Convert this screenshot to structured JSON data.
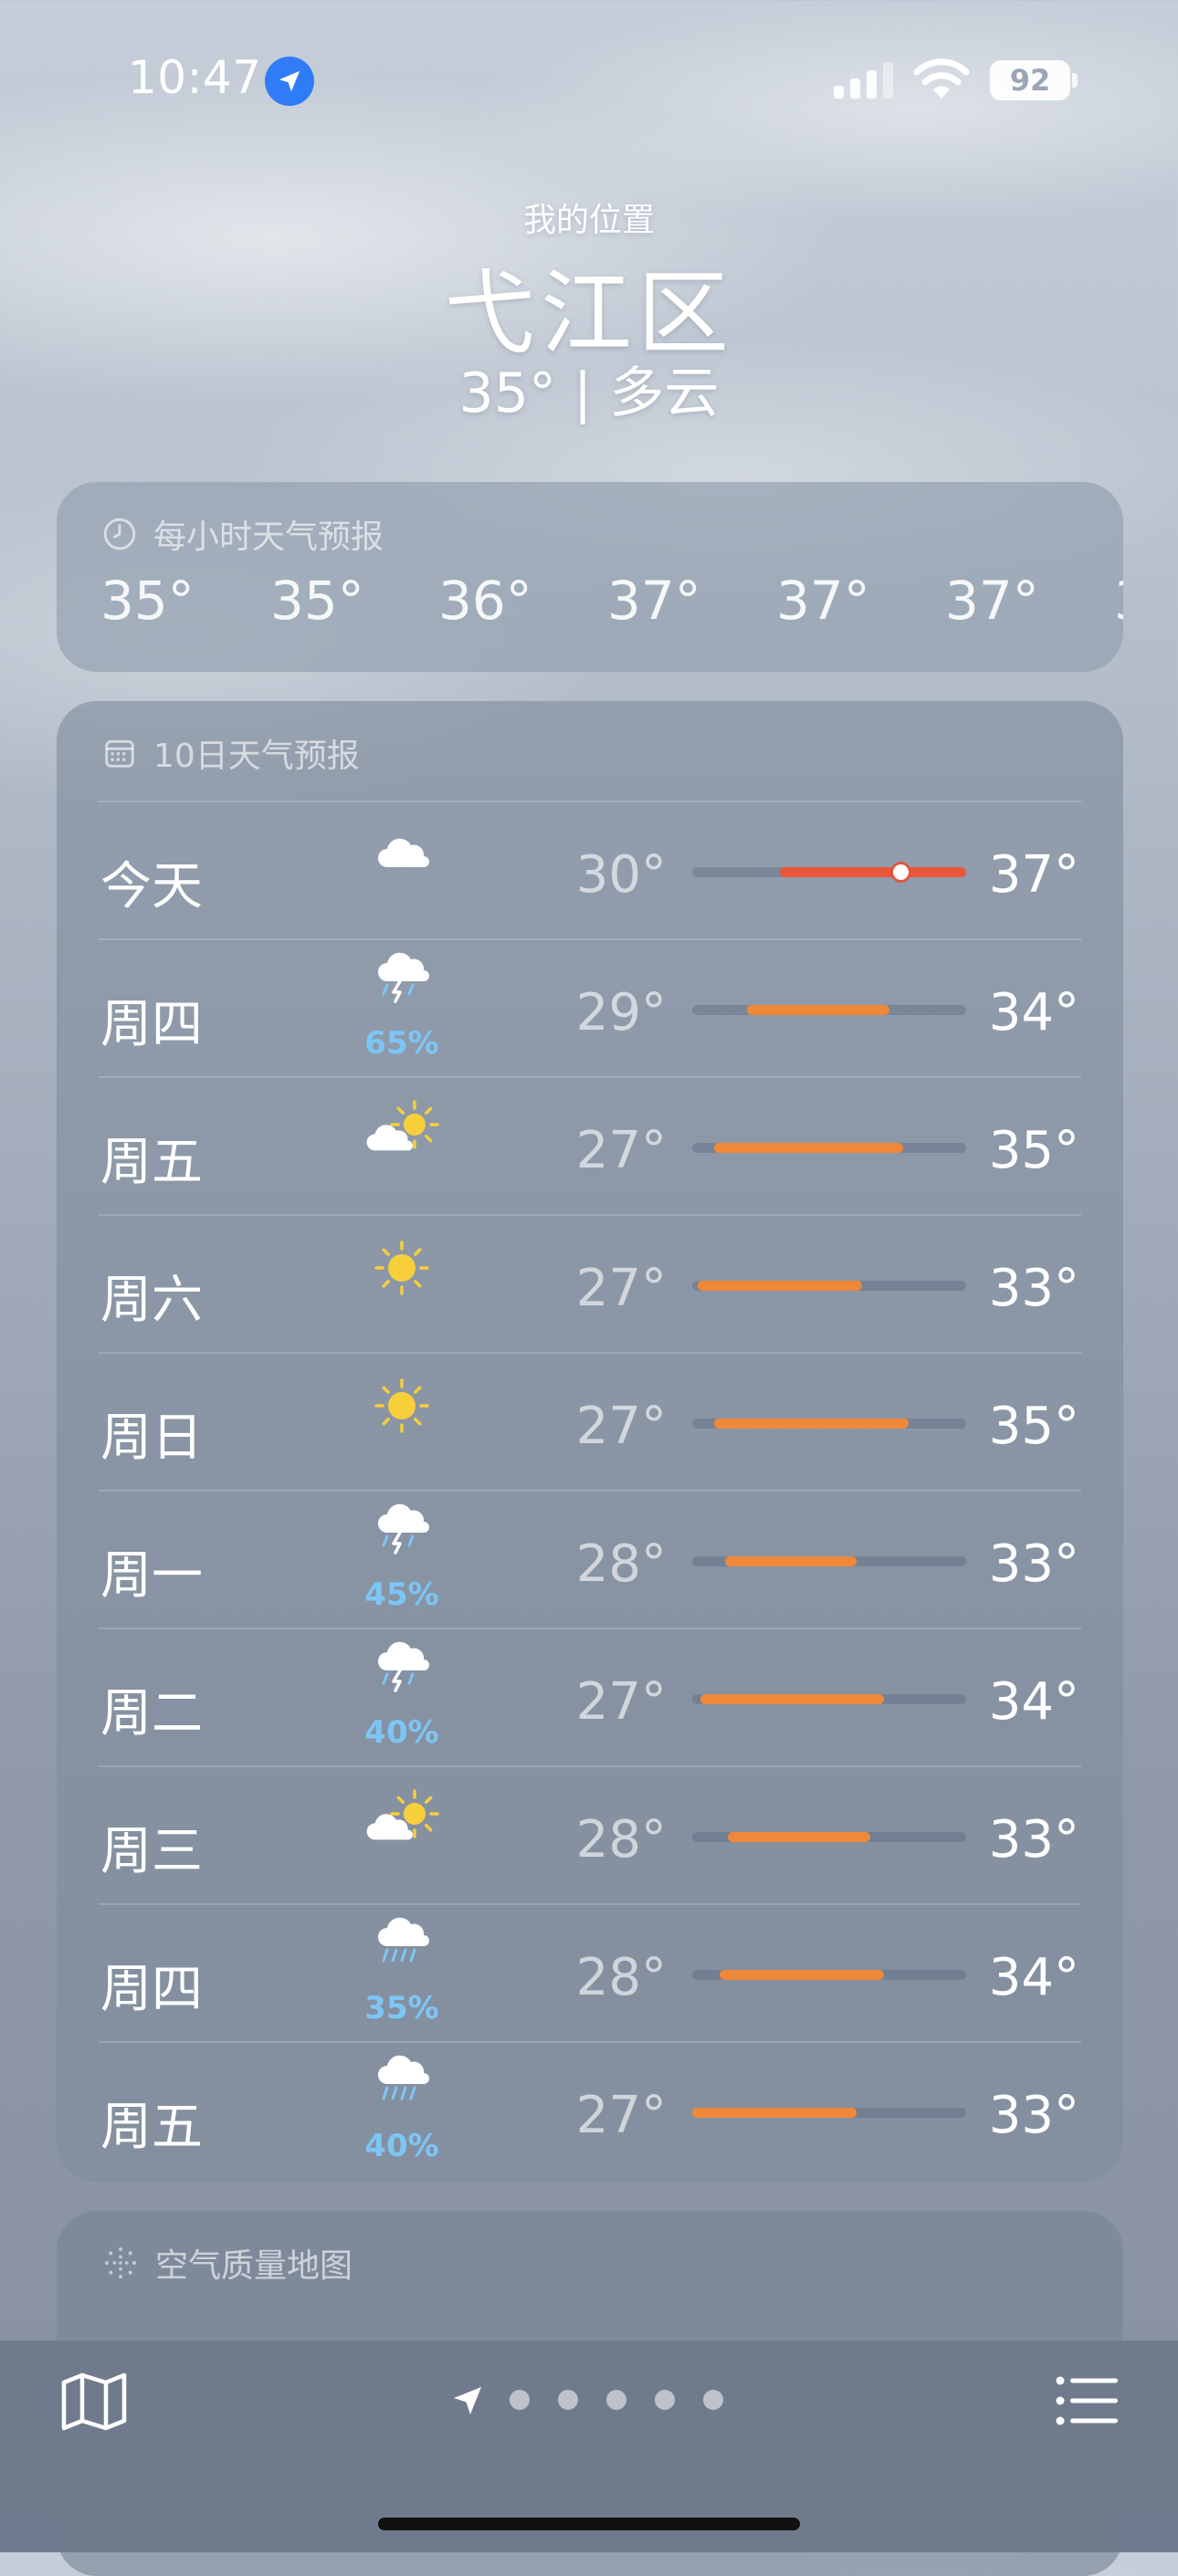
{
  "status": {
    "time": "10:47",
    "battery": "92"
  },
  "header": {
    "label": "我的位置",
    "city": "弋江区",
    "condition": "35° | 多云"
  },
  "hourly": {
    "title": "每小时天气预报",
    "temps": [
      "35°",
      "35°",
      "36°",
      "37°",
      "37°",
      "37°",
      "3"
    ]
  },
  "daily": {
    "title": "10日天气预报",
    "colors": {
      "bar_today": "#e8573a",
      "bar": "#f0883a",
      "precip_text": "#7cc6f5"
    },
    "rows": [
      {
        "day": "今天",
        "icon": "cloud-icon",
        "pop": "",
        "lo": "30°",
        "hi": "37°",
        "range": [
          0.32,
          1.0
        ],
        "current": 0.76
      },
      {
        "day": "周四",
        "icon": "thunderstorm-icon",
        "pop": "65%",
        "lo": "29°",
        "hi": "34°",
        "range": [
          0.2,
          0.72
        ]
      },
      {
        "day": "周五",
        "icon": "partly-cloudy-icon",
        "pop": "",
        "lo": "27°",
        "hi": "35°",
        "range": [
          0.08,
          0.77
        ]
      },
      {
        "day": "周六",
        "icon": "sun-icon",
        "pop": "",
        "lo": "27°",
        "hi": "33°",
        "range": [
          0.02,
          0.62
        ]
      },
      {
        "day": "周日",
        "icon": "sun-icon",
        "pop": "",
        "lo": "27°",
        "hi": "35°",
        "range": [
          0.08,
          0.79
        ]
      },
      {
        "day": "周一",
        "icon": "thunderstorm-icon",
        "pop": "45%",
        "lo": "28°",
        "hi": "33°",
        "range": [
          0.12,
          0.6
        ]
      },
      {
        "day": "周二",
        "icon": "thunderstorm-icon",
        "pop": "40%",
        "lo": "27°",
        "hi": "34°",
        "range": [
          0.03,
          0.7
        ]
      },
      {
        "day": "周三",
        "icon": "partly-cloudy-icon",
        "pop": "",
        "lo": "28°",
        "hi": "33°",
        "range": [
          0.13,
          0.65
        ]
      },
      {
        "day": "周四",
        "icon": "rain-icon",
        "pop": "35%",
        "lo": "28°",
        "hi": "34°",
        "range": [
          0.1,
          0.7
        ]
      },
      {
        "day": "周五",
        "icon": "rain-icon",
        "pop": "40%",
        "lo": "27°",
        "hi": "33°",
        "range": [
          0.0,
          0.6
        ]
      }
    ]
  },
  "aqi": {
    "title": "空气质量地图"
  },
  "tabbar": {
    "page_dots": 5
  }
}
